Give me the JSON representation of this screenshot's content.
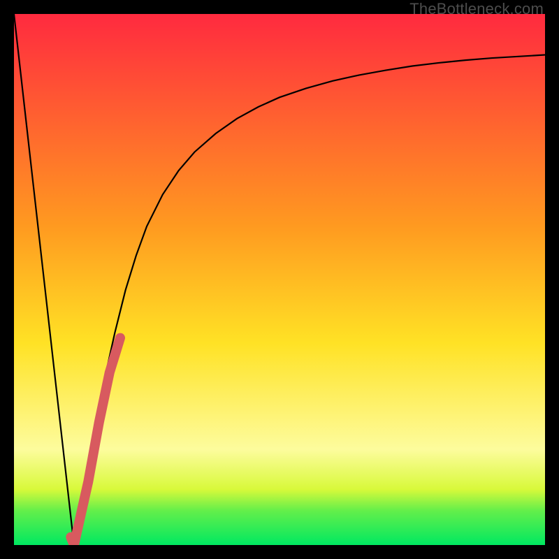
{
  "watermark": "TheBottleneck.com",
  "colors": {
    "background": "#000000",
    "curve": "#000000",
    "highlight": "#d85a5f",
    "green": "#00e861",
    "yellowGreen": "#d8f93a",
    "yellowPale": "#fdfc9d",
    "yellow": "#ffe225",
    "orange": "#ff9a20",
    "red": "#ff2a3f"
  },
  "chart_data": {
    "type": "line",
    "title": "",
    "xlabel": "",
    "ylabel": "",
    "xlim": [
      0,
      100
    ],
    "ylim": [
      0,
      100
    ],
    "series": [
      {
        "name": "bottleneck-curve",
        "x": [
          0,
          2,
          4,
          6,
          8,
          10,
          11.3,
          13,
          15,
          17,
          19,
          21,
          23,
          25,
          28,
          31,
          34,
          38,
          42,
          46,
          50,
          55,
          60,
          65,
          70,
          75,
          80,
          85,
          90,
          95,
          100
        ],
        "values": [
          100,
          82.3,
          64.6,
          46.9,
          29.2,
          11.5,
          0,
          8,
          20,
          31,
          40,
          48,
          54.5,
          60,
          66,
          70.5,
          74,
          77.5,
          80.3,
          82.5,
          84.3,
          86,
          87.4,
          88.5,
          89.4,
          90.2,
          90.8,
          91.3,
          91.7,
          92,
          92.3
        ]
      },
      {
        "name": "highlight-segment",
        "x": [
          10.7,
          11.3,
          14,
          16,
          18,
          20
        ],
        "values": [
          1.5,
          0,
          12,
          23,
          32.5,
          39
        ]
      }
    ],
    "gradient_stops": [
      {
        "offset": 0.0,
        "color": "#ff2a3f"
      },
      {
        "offset": 0.4,
        "color": "#ff9a20"
      },
      {
        "offset": 0.62,
        "color": "#ffe225"
      },
      {
        "offset": 0.82,
        "color": "#fdfc9d"
      },
      {
        "offset": 0.895,
        "color": "#d8f93a"
      },
      {
        "offset": 0.935,
        "color": "#64ef4a"
      },
      {
        "offset": 1.0,
        "color": "#00e861"
      }
    ]
  }
}
